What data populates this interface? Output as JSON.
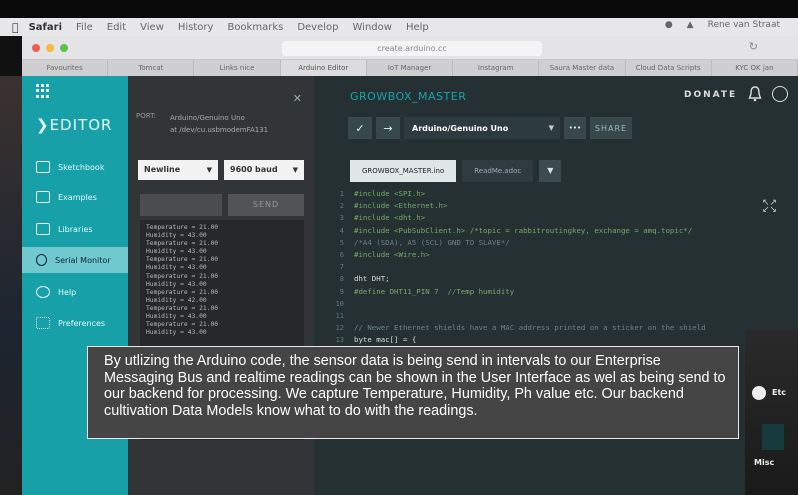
{
  "menubar": {
    "items": [
      "Safari",
      "File",
      "Edit",
      "View",
      "History",
      "Bookmarks",
      "Develop",
      "Window",
      "Help"
    ],
    "user": "Rene van Straat"
  },
  "safari": {
    "url": "create.arduino.cc",
    "tabs": [
      "Favourites",
      "Tomcat",
      "Links nice",
      "Arduino Editor",
      "IoT Manager",
      "Instagram",
      "Saura Master data",
      "Cloud Data Scripts",
      "KYC OK jan"
    ]
  },
  "sidebar": {
    "logo": "EDITOR",
    "items": [
      {
        "label": "Sketchbook",
        "icon": "folder-icon"
      },
      {
        "label": "Examples",
        "icon": "examples-icon"
      },
      {
        "label": "Libraries",
        "icon": "libraries-icon"
      },
      {
        "label": "Serial Monitor",
        "icon": "search-icon"
      },
      {
        "label": "Help",
        "icon": "help-icon"
      },
      {
        "label": "Preferences",
        "icon": "preferences-icon"
      }
    ]
  },
  "serial": {
    "port_label": "PORT:",
    "port_name": "Arduino/Genuino Uno",
    "port_path": "at /dev/cu.usbmodemFA131",
    "line_ending": "Newline",
    "baud": "9600 baud",
    "send_label": "SEND",
    "output": [
      "Temperature = 21.00",
      "Humidity = 43.00",
      "Temperature = 21.00",
      "Humidity = 43.00",
      "Temperature = 21.00",
      "Humidity = 43.00",
      "Temperature = 21.00",
      "Humidity = 43.00",
      "Temperature = 21.00",
      "Humidity = 42.00",
      "Temperature = 21.00",
      "Humidity = 43.00",
      "Temperature = 21.00",
      "Humidity = 43.00"
    ]
  },
  "header": {
    "sketch_name": "GROWBOX_MASTER",
    "donate": "DONATE"
  },
  "toolbar": {
    "board": "Arduino/Genuino Uno",
    "more": "•••",
    "share": "SHARE"
  },
  "tabs": [
    "GROWBOX_MASTER.ino",
    "ReadMe.adoc"
  ],
  "code": {
    "line_numbers": [
      "1",
      "2",
      "3",
      "4",
      "5",
      "6",
      "7",
      "8",
      "9",
      "10",
      "11",
      "12",
      "13"
    ],
    "lines": [
      "#include <SPI.h>",
      "#include <Ethernet.h>",
      "#include <dht.h>",
      "#include <PubSubClient.h> /*topic = rabbitroutingkey, exchange = amq.topic*/",
      "/*A4 (SDA), A5 (SCL) GND TO SLAVE*/",
      "#include <Wire.h>",
      "",
      "dht DHT;",
      "#define DHT11_PIN 7  //Temp humidity",
      "",
      "",
      "// Newer Ethernet shields have a MAC address printed on a sticker on the shield",
      "byte mac[] = {"
    ]
  },
  "desk": {
    "misc": "Misc",
    "etc": "Etc"
  },
  "caption": {
    "text": "By utlizing the Arduino code, the sensor data is being send in intervals to our Enterprise Messaging Bus and realtime readings can be shown in the User Interface as wel as being send to our backend for processing. We capture Temperature, Humidity, Ph value etc. Our backend cultivation Data Models know what to do with the readings."
  }
}
